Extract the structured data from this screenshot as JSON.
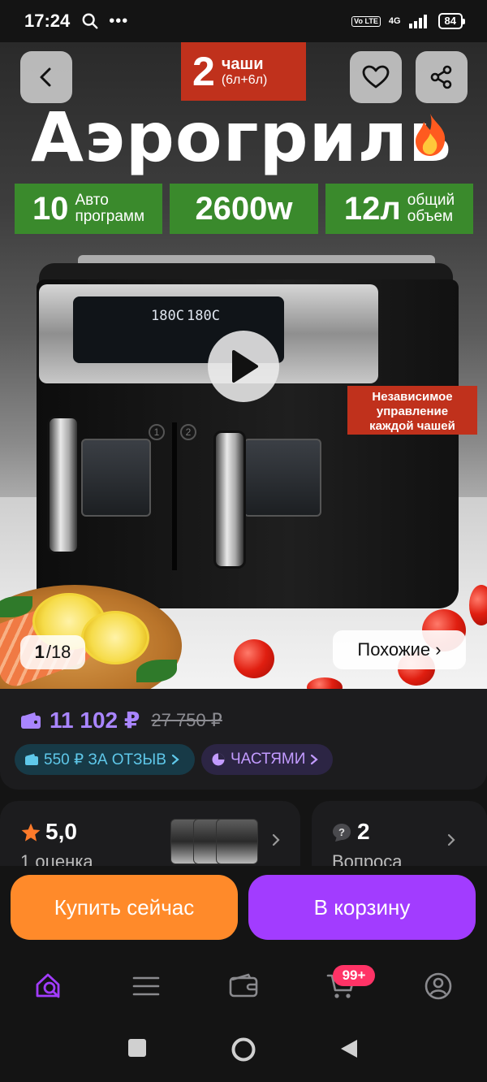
{
  "status_bar": {
    "time": "17:24",
    "volte": "Vo LTE",
    "network": "4G",
    "battery": "84"
  },
  "hero": {
    "badge_count": "2",
    "badge_word": "чаши",
    "badge_sizes": "(6л+6л)",
    "title": "Аэрогриль",
    "features": [
      {
        "num": "10",
        "label_line1": "Авто",
        "label_line2": "программ"
      },
      {
        "num": "2600w",
        "label_line1": "",
        "label_line2": ""
      },
      {
        "num": "12л",
        "label_line1": "общий",
        "label_line2": "объем"
      }
    ],
    "panel_display_left": "180C",
    "panel_display_right": "180C",
    "independent_line1": "Независимое",
    "independent_line2": "управление",
    "independent_line3": "каждой чашей",
    "counter_current": "1",
    "counter_total": "/18",
    "similar_label": "Похожие ›"
  },
  "price": {
    "current": "11 102 ₽",
    "old": "27 750 ₽",
    "review_chip": "550 ₽ ЗА ОТЗЫВ",
    "parts_chip": "ЧАСТЯМИ"
  },
  "rating_card": {
    "value": "5,0",
    "subtitle": "1 оценка"
  },
  "questions_card": {
    "value": "2",
    "subtitle": "Вопроса"
  },
  "actions": {
    "buy_now": "Купить сейчас",
    "add_to_cart": "В корзину"
  },
  "bottom_nav": {
    "cart_badge": "99+",
    "items": [
      "home-search-icon",
      "menu-icon",
      "wallet-icon",
      "cart-icon",
      "profile-icon"
    ]
  },
  "colors": {
    "accent_purple": "#a23cff",
    "accent_orange": "#ff8a2a",
    "price_purple": "#a985ff",
    "badge_red": "#c0311c",
    "feature_green": "#3a8a2c"
  }
}
